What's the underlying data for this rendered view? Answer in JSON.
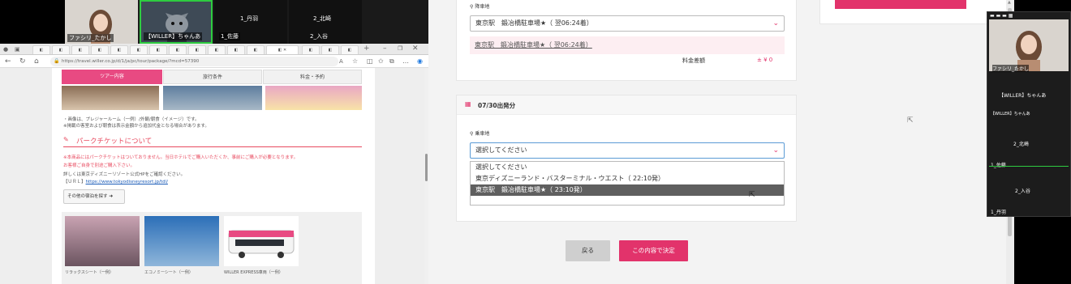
{
  "video_strip": {
    "tiles": [
      {
        "name": "ファシリ_たかし"
      },
      {
        "name": "【WILLER】ちゃんあ"
      },
      {
        "name": "1_丹羽"
      },
      {
        "name": "2_北崎"
      },
      {
        "name": "1_佐藤"
      },
      {
        "name": "2_入谷"
      }
    ]
  },
  "browser": {
    "url": "https://travel.willer.co.jp/d/1/ja/pc/tour/package/?mcd=57390",
    "tour_tabs": [
      "ツアー内容",
      "旅行条件",
      "料金・予約"
    ],
    "image_notes": [
      "・画像は、プレジャールーム（一例）/外観/朝食（イメージ）です。",
      "※掲載の客室および朝食は表示金額から追加代金となる場合があります。"
    ],
    "park_ticket": {
      "heading": "パークチケットについて",
      "notes": [
        "※本商品にはパークチケットはついておりません。当日ホテルでご購入いただくか、事前にご購入が必要となります。",
        "お客様ご自身で別途ご購入下さい。"
      ],
      "info": "詳しくは東京ディズニーリゾート公式HPをご確認ください。",
      "url_label": "【ＵＲＬ】",
      "url": "https://www.tokyodisneyresort.jp/tdl/",
      "other_btn": "その他の宿泊を探す"
    },
    "bus_captions": [
      "リラックスシート（一例）",
      "エコノミーシート（一例）",
      "WILLER EXPRESS車両（一例）"
    ]
  },
  "booking": {
    "arrival_label": "降車地",
    "arrival_selected": "東京駅　鍛冶橋駐車場★（ 翌06:24着）",
    "arrival_confirm": "東京駅　鍛冶橋駐車場★（ 翌06:24着）",
    "price_label": "料金差額",
    "price_value": "± ¥ 0",
    "departure_date": "07/30出発分",
    "boarding_label": "乗車地",
    "boarding_placeholder": "選択してください",
    "options": [
      "選択してください",
      "東京ディズニーランド・バスターミナル・ウエスト（ 22:10発）",
      "東京駅　鍛冶橋駐車場★（ 23:10発）"
    ],
    "highlighted_option": 2,
    "back_btn": "戻る",
    "confirm_btn": "この内容で決定"
  },
  "zoom_panel": {
    "labels": [
      "ファシリ_たかし",
      "【WILLER】ちゃんあ",
      "【WILLER】ちゃんあ",
      "2_北崎",
      "1_佐藤",
      "2_入谷",
      "1_丹羽"
    ]
  },
  "colors": {
    "accent": "#e2336b",
    "pink_light": "#fdeef2"
  }
}
